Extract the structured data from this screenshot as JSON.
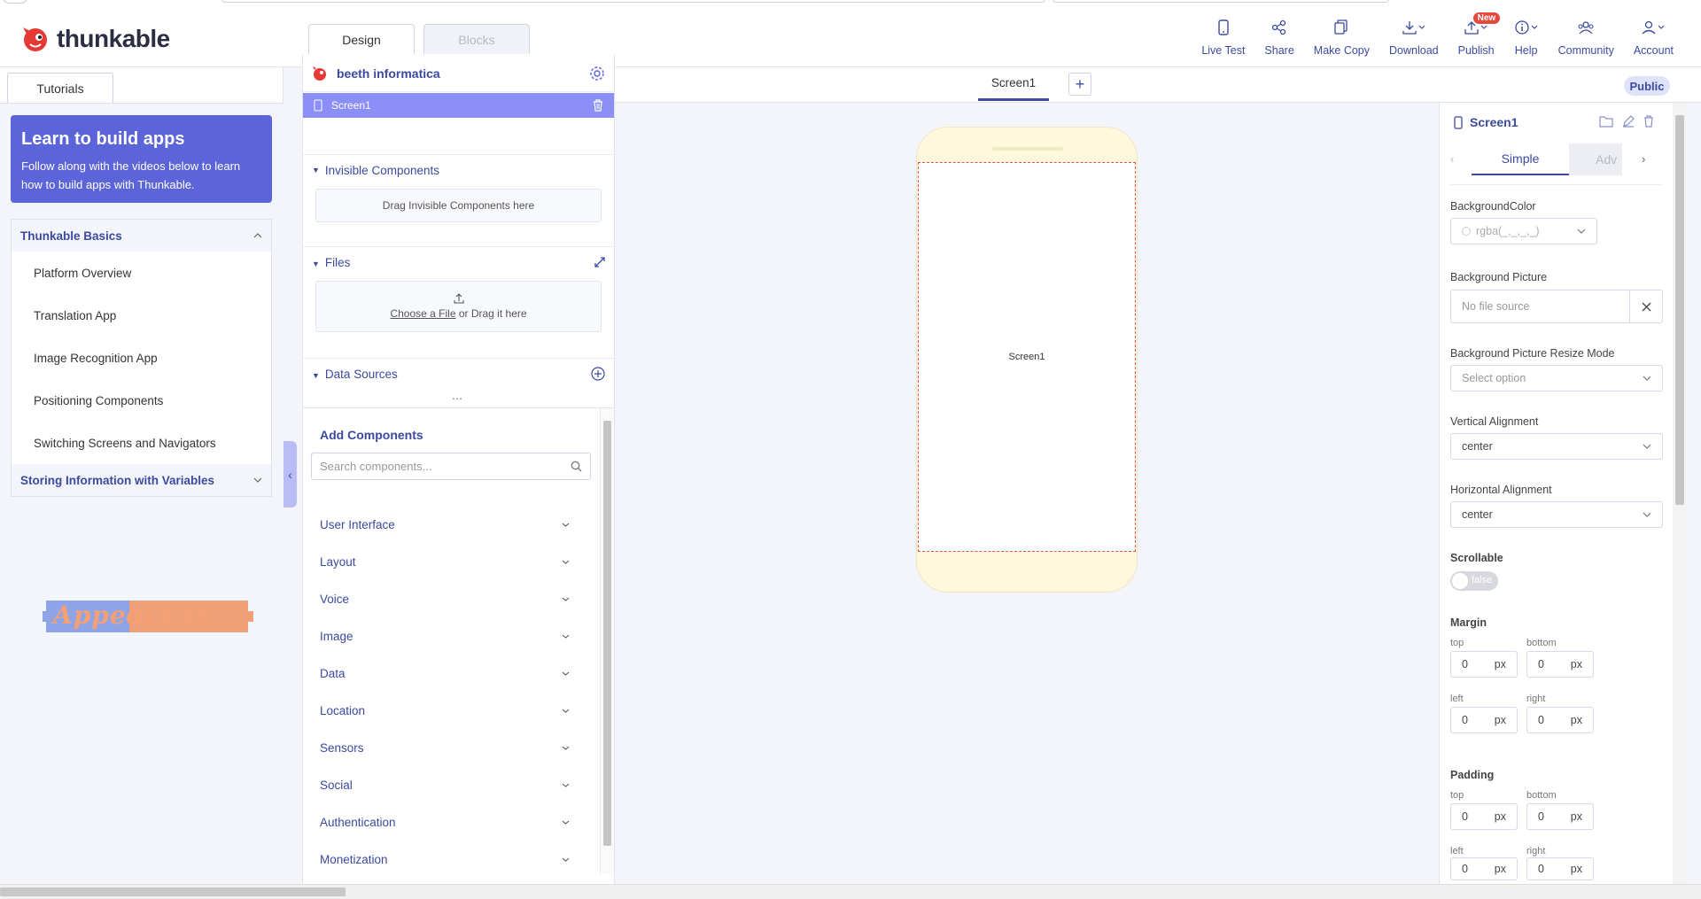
{
  "brand": {
    "name": "thunkable"
  },
  "editor_tabs": {
    "design": "Design",
    "blocks": "Blocks"
  },
  "toolbar": {
    "live_test": "Live Test",
    "share": "Share",
    "make_copy": "Make Copy",
    "download": "Download",
    "publish": "Publish",
    "publish_badge": "New",
    "help": "Help",
    "community": "Community",
    "account": "Account"
  },
  "tutorials": {
    "tab": "Tutorials",
    "banner_title": "Learn to build apps",
    "banner_text": "Follow along with the videos below to learn how to build apps with Thunkable.",
    "section_open": "Thunkable Basics",
    "lessons": [
      "Platform Overview",
      "Translation App",
      "Image Recognition App",
      "Positioning Components",
      "Switching Screens and Navigators"
    ],
    "section_closed": "Storing Information with Variables",
    "sponsor_logo": "AppediA.it"
  },
  "tree": {
    "project_name": "beeth informatica",
    "screen": "Screen1",
    "invisible_title": "Invisible Components",
    "invisible_drop": "Drag Invisible Components here",
    "files_title": "Files",
    "files_choose": "Choose a File",
    "files_or": " or Drag it here",
    "datasources_title": "Data Sources"
  },
  "add_components": {
    "title": "Add Components",
    "search_placeholder": "Search components...",
    "categories": [
      "User Interface",
      "Layout",
      "Voice",
      "Image",
      "Data",
      "Location",
      "Sensors",
      "Social",
      "Authentication",
      "Monetization"
    ]
  },
  "canvas": {
    "screen_tab": "Screen1",
    "visibility": "Public",
    "phone_label": "Screen1"
  },
  "properties": {
    "title": "Screen1",
    "tab_simple": "Simple",
    "tab_advanced": "Adv",
    "bg_color_label": "BackgroundColor",
    "bg_color_value": "rgba(_,_,_,_)",
    "bg_picture_label": "Background Picture",
    "bg_picture_value": "No file source",
    "resize_label": "Background Picture Resize Mode",
    "resize_value": "Select option",
    "valign_label": "Vertical Alignment",
    "valign_value": "center",
    "halign_label": "Horizontal Alignment",
    "halign_value": "center",
    "scrollable_label": "Scrollable",
    "scrollable_value": "false",
    "margin_label": "Margin",
    "padding_label": "Padding",
    "top": "top",
    "bottom": "bottom",
    "left": "left",
    "right": "right",
    "zero": "0",
    "unit": "px"
  }
}
